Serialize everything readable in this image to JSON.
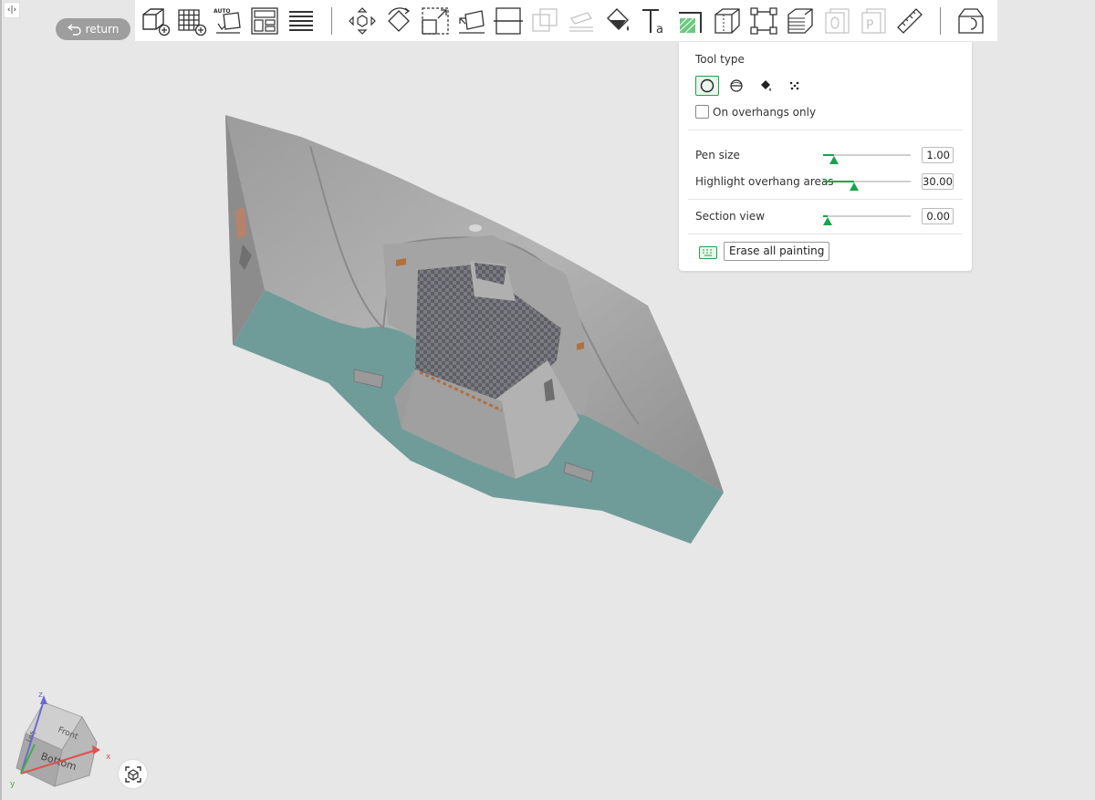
{
  "header": {
    "return_label": "return",
    "collapse_glyph": "‹|›"
  },
  "toolbar": {
    "buttons": [
      {
        "name": "add-object-icon"
      },
      {
        "name": "add-plate-icon"
      },
      {
        "name": "auto-orient-icon",
        "badge": "AUTO"
      },
      {
        "name": "arrange-icon"
      },
      {
        "name": "layers-icon"
      },
      {
        "name": "move-icon"
      },
      {
        "name": "rotate-icon"
      },
      {
        "name": "scale-icon"
      },
      {
        "name": "lay-on-face-icon"
      },
      {
        "name": "cut-icon"
      },
      {
        "name": "boolean-icon",
        "disabled": true
      },
      {
        "name": "support-paint-placeholder-icon",
        "disabled": true
      },
      {
        "name": "fill-bucket-icon"
      },
      {
        "name": "text-icon"
      },
      {
        "name": "support-painting-icon"
      },
      {
        "name": "seam-painting-icon"
      },
      {
        "name": "simplify-icon"
      },
      {
        "name": "variable-layer-height-icon"
      },
      {
        "name": "assembly-icon",
        "disabled": true
      },
      {
        "name": "plate-label-icon",
        "disabled": true,
        "badge": "P"
      },
      {
        "name": "measure-icon"
      },
      {
        "name": "assembly-view-icon"
      }
    ]
  },
  "panel": {
    "tool_type_label": "Tool type",
    "on_overhangs_label": "On overhangs only",
    "pen_size_label": "Pen size",
    "pen_size_value": "1.00",
    "pen_size_fraction": 0.12,
    "overhang_label": "Highlight overhang areas",
    "overhang_value": "30.00",
    "overhang_fraction": 0.35,
    "section_label": "Section view",
    "section_value": "0.00",
    "section_fraction": 0.05,
    "erase_label": "Erase all painting"
  },
  "nav_cube": {
    "face_front": "Front",
    "face_left": "Left",
    "face_bottom": "Bottom",
    "axis_x": "x",
    "axis_y": "y",
    "axis_z": "z",
    "color_x": "#e05050",
    "color_y": "#40b040",
    "color_z": "#6a6ad0"
  },
  "colors": {
    "accent": "#1aa34a",
    "model_gray": "#a9a9a9",
    "model_teal": "#6f9c99"
  }
}
